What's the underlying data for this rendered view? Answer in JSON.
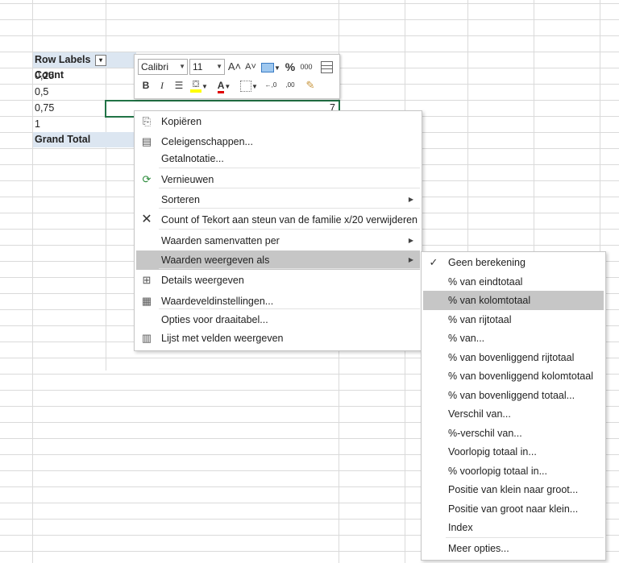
{
  "sheet": {
    "pivot_header": "Row Labels",
    "pivot_header_value": "Count",
    "rows": [
      "0,25",
      "0,5",
      "0,75",
      "1"
    ],
    "grand_total": "Grand Total",
    "selected_value": "7"
  },
  "mini_toolbar": {
    "font": "Calibri",
    "size": "11",
    "grow": "A˄",
    "shrink": "A˅",
    "percent": "%",
    "thousands": "000",
    "bold": "B",
    "italic": "I",
    "font_color": "A",
    "inc_decimal": "←,0",
    "dec_decimal": ",00"
  },
  "context_menu": {
    "items": [
      {
        "label": "Kopiëren",
        "icon": "copy-icon"
      },
      {
        "label": "Celeigenschappen...",
        "icon": "format-cells-icon"
      },
      {
        "label": "Getalnotatie..."
      },
      {
        "label": "Vernieuwen",
        "icon": "refresh-icon"
      },
      {
        "label": "Sorteren",
        "submenu": true
      },
      {
        "label": "Count of Tekort aan steun van de familie x/20 verwijderen",
        "icon": "remove-icon"
      },
      {
        "label": "Waarden samenvatten per",
        "submenu": true
      },
      {
        "label": "Waarden weergeven als",
        "submenu": true,
        "highlighted": true
      },
      {
        "label": "Details weergeven",
        "icon": "details-icon"
      },
      {
        "label": "Waardeveldinstellingen...",
        "icon": "field-settings-icon"
      },
      {
        "label": "Opties voor draaitabel..."
      },
      {
        "label": "Lijst met velden weergeven",
        "icon": "field-list-icon"
      }
    ]
  },
  "submenu": {
    "items": [
      {
        "label": "Geen berekening",
        "checked": true
      },
      {
        "label": "% van eindtotaal"
      },
      {
        "label": "% van kolomtotaal",
        "highlighted": true
      },
      {
        "label": "% van rijtotaal"
      },
      {
        "label": "% van..."
      },
      {
        "label": "% van bovenliggend rijtotaal"
      },
      {
        "label": "% van bovenliggend kolomtotaal"
      },
      {
        "label": "% van bovenliggend totaal..."
      },
      {
        "label": "Verschil van..."
      },
      {
        "label": "%-verschil van..."
      },
      {
        "label": "Voorlopig totaal in..."
      },
      {
        "label": "% voorlopig totaal in..."
      },
      {
        "label": "Positie van klein naar groot..."
      },
      {
        "label": "Positie van groot naar klein..."
      },
      {
        "label": "Index"
      },
      {
        "label": "Meer opties..."
      }
    ]
  },
  "colors": {
    "accent": "#217346",
    "highlight": "#c6c6c6",
    "pivot_header_bg": "#dce6f1"
  }
}
